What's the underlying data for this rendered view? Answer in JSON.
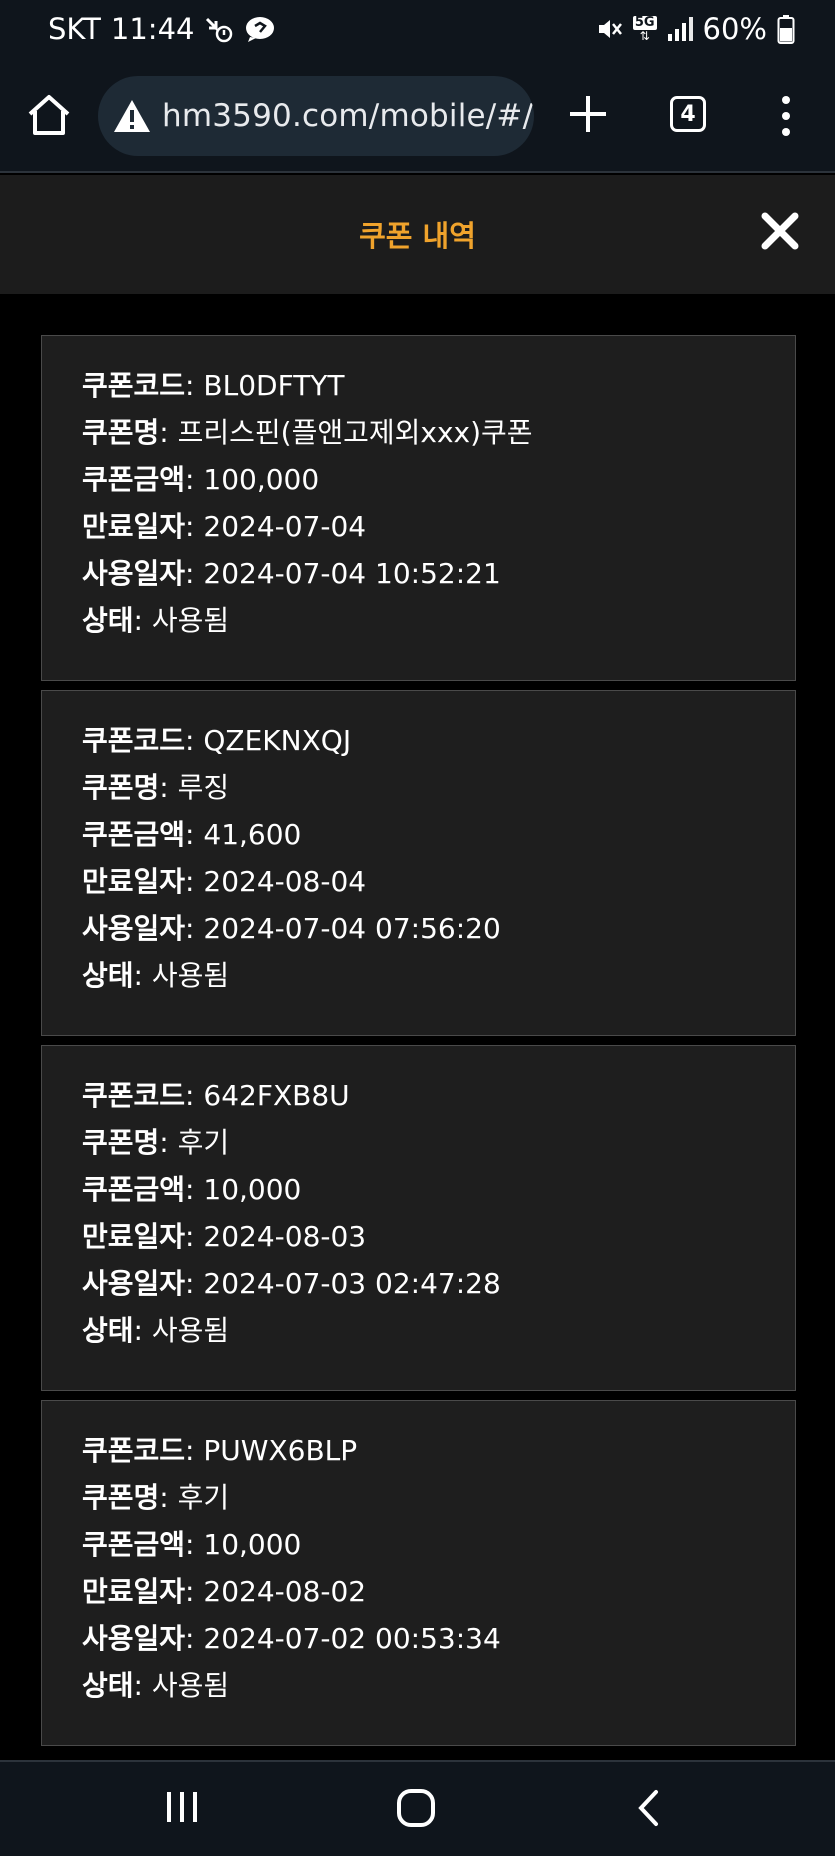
{
  "status_bar": {
    "carrier": "SKT",
    "time": "11:44",
    "network": "5G",
    "battery": "60%"
  },
  "browser": {
    "url": "hm3590.com/mobile/#/",
    "tab_count": "4"
  },
  "header": {
    "title": "쿠폰 내역"
  },
  "labels": {
    "code": "쿠폰코드",
    "name": "쿠폰명",
    "amount": "쿠폰금액",
    "expiry": "만료일자",
    "used": "사용일자",
    "status": "상태"
  },
  "coupons": [
    {
      "code": "BL0DFTYT",
      "name": "프리스핀(플앤고제외xxx)쿠폰",
      "amount": "100,000",
      "expiry": "2024-07-04",
      "used": "2024-07-04 10:52:21",
      "status": "사용됨"
    },
    {
      "code": "QZEKNXQJ",
      "name": "루징",
      "amount": "41,600",
      "expiry": "2024-08-04",
      "used": "2024-07-04 07:56:20",
      "status": "사용됨"
    },
    {
      "code": "642FXB8U",
      "name": "후기",
      "amount": "10,000",
      "expiry": "2024-08-03",
      "used": "2024-07-03 02:47:28",
      "status": "사용됨"
    },
    {
      "code": "PUWX6BLP",
      "name": "후기",
      "amount": "10,000",
      "expiry": "2024-08-02",
      "used": "2024-07-02 00:53:34",
      "status": "사용됨"
    }
  ],
  "colors": {
    "title": "#f0a32c",
    "card_bg": "#1e1e1e",
    "card_border": "#4a4a4a",
    "chrome_bg": "#0f151c",
    "header_bg": "#1c1c1c"
  }
}
